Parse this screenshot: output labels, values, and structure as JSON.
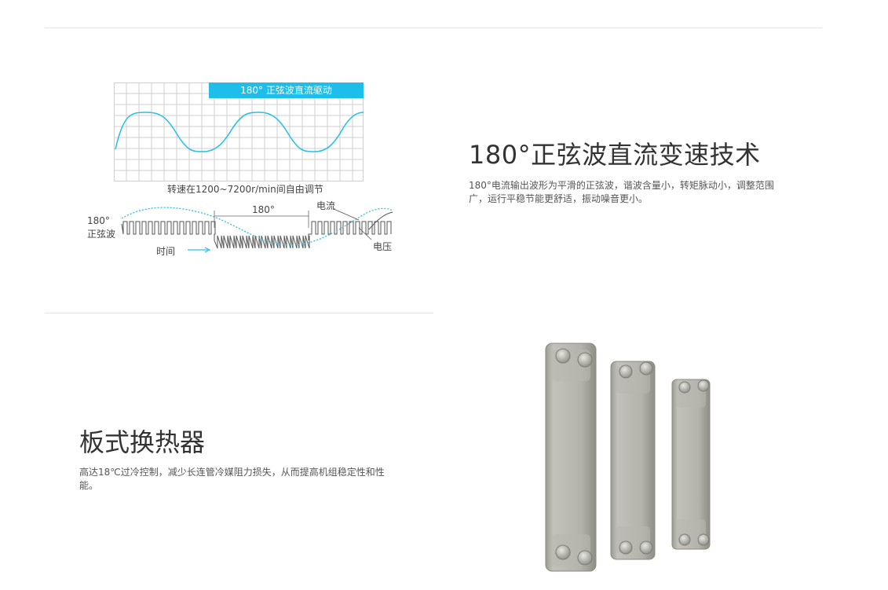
{
  "diagram": {
    "banner": "180° 正弦波直流驱动",
    "speed_caption": "转速在1200~7200r/min间自由调节",
    "label_180_sine_line1": "180°",
    "label_180_sine_line2": "正弦波",
    "label_180": "180°",
    "label_current": "电流",
    "label_voltage": "电压",
    "label_time": "时间",
    "accent_color": "#1ebdea"
  },
  "section1": {
    "title": "180°正弦波直流变速技术",
    "description": "180°电流输出波形为平滑的正弦波，谐波含量小，转矩脉动小，调整范围广，运行平稳节能更舒适，振动噪音更小。"
  },
  "section2": {
    "title": "板式换热器",
    "description": "高达18℃过冷控制，减少长连管冷媒阻力损失，从而提高机组稳定性和性能。"
  }
}
